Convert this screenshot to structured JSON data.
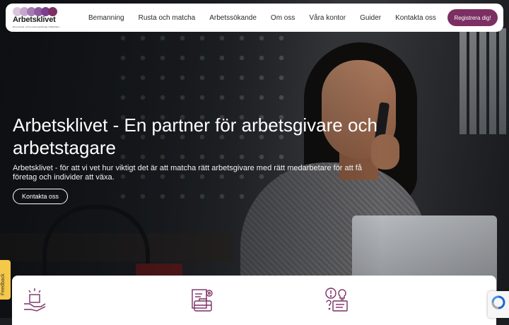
{
  "brand": {
    "name": "Arbetsklivet",
    "tagline": "Ett personal- och bemanningsföretag i Mälardalen",
    "accent": "#7b2f63",
    "logo_colors": [
      "#d9c6dd",
      "#c5a9cd",
      "#a67bb3",
      "#8f5aa0",
      "#7b3f8c"
    ]
  },
  "header": {
    "nav": [
      "Bemanning",
      "Rusta och matcha",
      "Arbetssökande",
      "Om oss",
      "Våra kontor",
      "Guider",
      "Kontakta oss"
    ],
    "register_label": "Registrera dig!"
  },
  "hero": {
    "title": "Arbetsklivet - En partner för arbetsgivare och arbetstagare",
    "description": "Arbetsklivet - för att vi vet hur viktigt det är att matcha rätt arbetsgivare med rätt medarbetare för att få företag och individer att växa.",
    "cta_label": "Kontakta oss"
  },
  "feedback": {
    "label": "Feedback",
    "color": "#f5c84a"
  },
  "cards": {
    "icons": [
      "box-hand-icon",
      "briefcase-gear-icon",
      "idea-question-icon"
    ]
  }
}
